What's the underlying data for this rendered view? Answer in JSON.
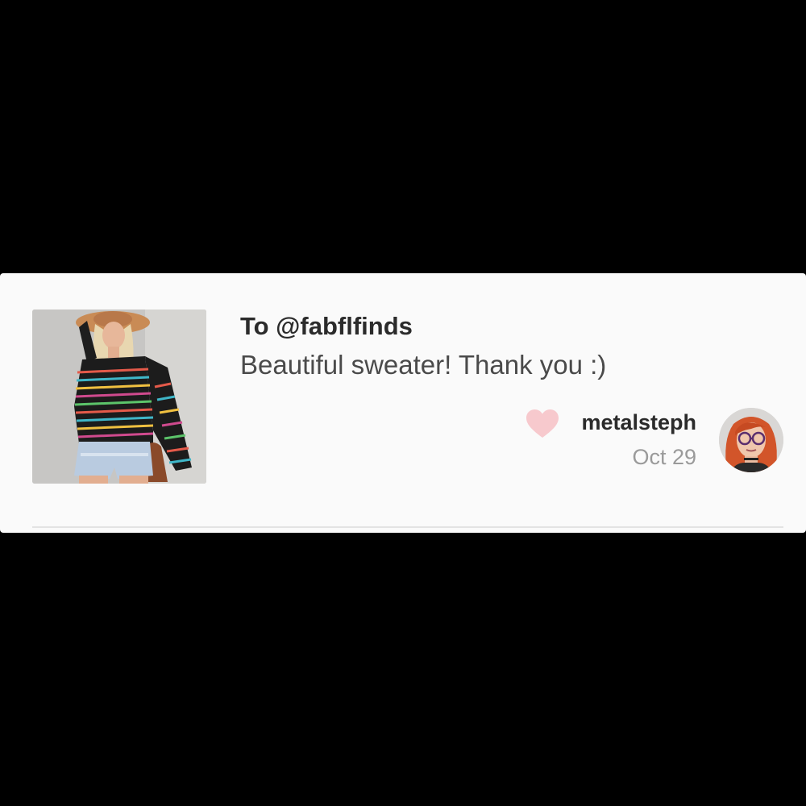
{
  "review": {
    "recipient": "To @fabflfinds",
    "message": "Beautiful sweater! Thank you :)",
    "reviewer": {
      "username": "metalsteph",
      "date": "Oct 29"
    },
    "liked": true
  },
  "icons": {
    "like": "heart-icon"
  },
  "colors": {
    "background": "#000000",
    "card": "#fafafa",
    "heart": "#f7c9cd",
    "title_text": "#2b2b2b",
    "body_text": "#4a4a4a",
    "muted_text": "#9a9a9a"
  }
}
